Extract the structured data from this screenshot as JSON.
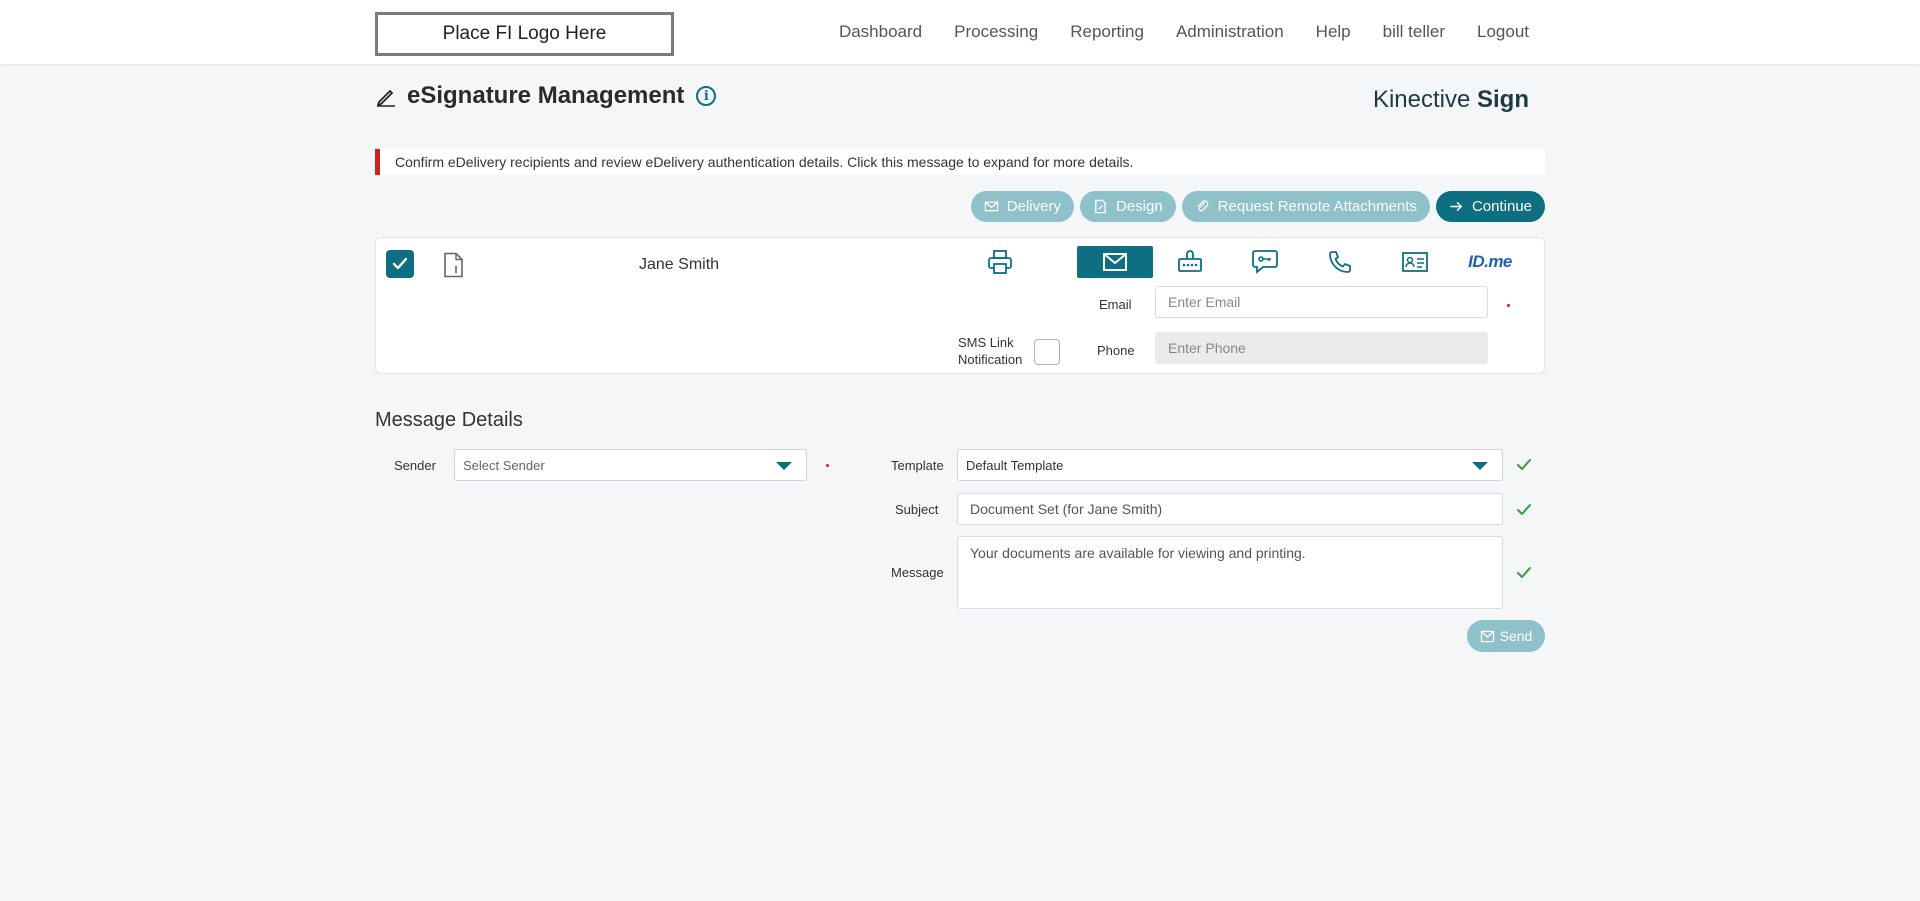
{
  "header": {
    "logo_text": "Place FI Logo Here",
    "nav": [
      "Dashboard",
      "Processing",
      "Reporting",
      "Administration",
      "Help",
      "bill teller",
      "Logout"
    ]
  },
  "page": {
    "title": "eSignature Management",
    "brand_light": "Kinective ",
    "brand_bold": "Sign"
  },
  "alert": {
    "text": "Confirm eDelivery recipients and review eDelivery authentication details. Click this message to expand for more details.",
    "color": "#d0201f"
  },
  "actions": {
    "delivery": "Delivery",
    "design": "Design",
    "remote": "Request Remote Attachments",
    "continue": "Continue"
  },
  "recipient": {
    "name": "Jane Smith",
    "selected": true,
    "methods": [
      "print-icon",
      "email-icon",
      "kba-icon",
      "sms-passcode-icon",
      "phone-icon",
      "id-card-icon",
      "idme-icon"
    ],
    "active_method": "email-icon",
    "idme_label": "ID.me",
    "email_label": "Email",
    "email_placeholder": "Enter Email",
    "sms_label": "SMS Link Notification",
    "phone_label": "Phone",
    "phone_placeholder": "Enter Phone"
  },
  "message_details": {
    "title": "Message Details",
    "sender_label": "Sender",
    "sender_value": "Select Sender",
    "template_label": "Template",
    "template_value": "Default Template",
    "subject_label": "Subject",
    "subject_value": "Document Set (for Jane Smith)",
    "message_label": "Message",
    "message_value": "Your documents are available for viewing and printing.",
    "send": "Send"
  },
  "colors": {
    "accent": "#0e6f83",
    "accent_light": "#8fc1cb",
    "valid": "#3c9a3c",
    "required": "#d0201f"
  }
}
